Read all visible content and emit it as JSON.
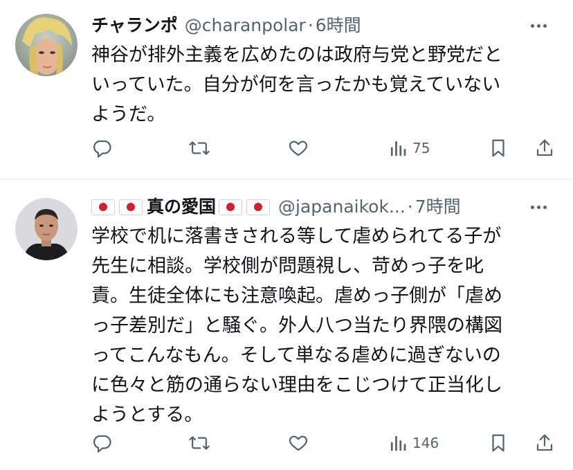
{
  "tweets": [
    {
      "display_name": "チャランポ",
      "handle": "@charanpolar",
      "separator": "·",
      "time": "6時間",
      "text": "神谷が排外主義を広めたのは政府与党と野党だと\nいっていた。自分が何を言ったかも覚えていない\nようだ。",
      "views": "75",
      "avatar": "avatar-blonde-anime-character"
    },
    {
      "display_name": "真の愛国",
      "handle": "@japanaikok...",
      "separator": "·",
      "time": "7時間",
      "text": "学校で机に落書きされる等して虐められてる子が\n先生に相談。学校側が問題視し、苛めっ子を叱\n責。生徒全体にも注意喚起。虐めっ子側が「虐め\nっ子差別だ」と騒ぐ。外人八つ当たり界隈の構図\nってこんなもん。そして単なる虐めに過ぎないの\nに色々と筋の通らない理由をこじつけて正当化し\nようとする。",
      "views": "146",
      "avatar": "avatar-man-photo",
      "name_flags": "japan-flag-icon"
    }
  ],
  "colors": {
    "text": "#0f1419",
    "muted": "#536471",
    "divider": "#e6e9ec",
    "flag_red": "#d21f2f"
  },
  "icons": [
    "reply-icon",
    "retweet-icon",
    "like-icon",
    "views-icon",
    "bookmark-icon",
    "share-icon",
    "more-icon"
  ]
}
